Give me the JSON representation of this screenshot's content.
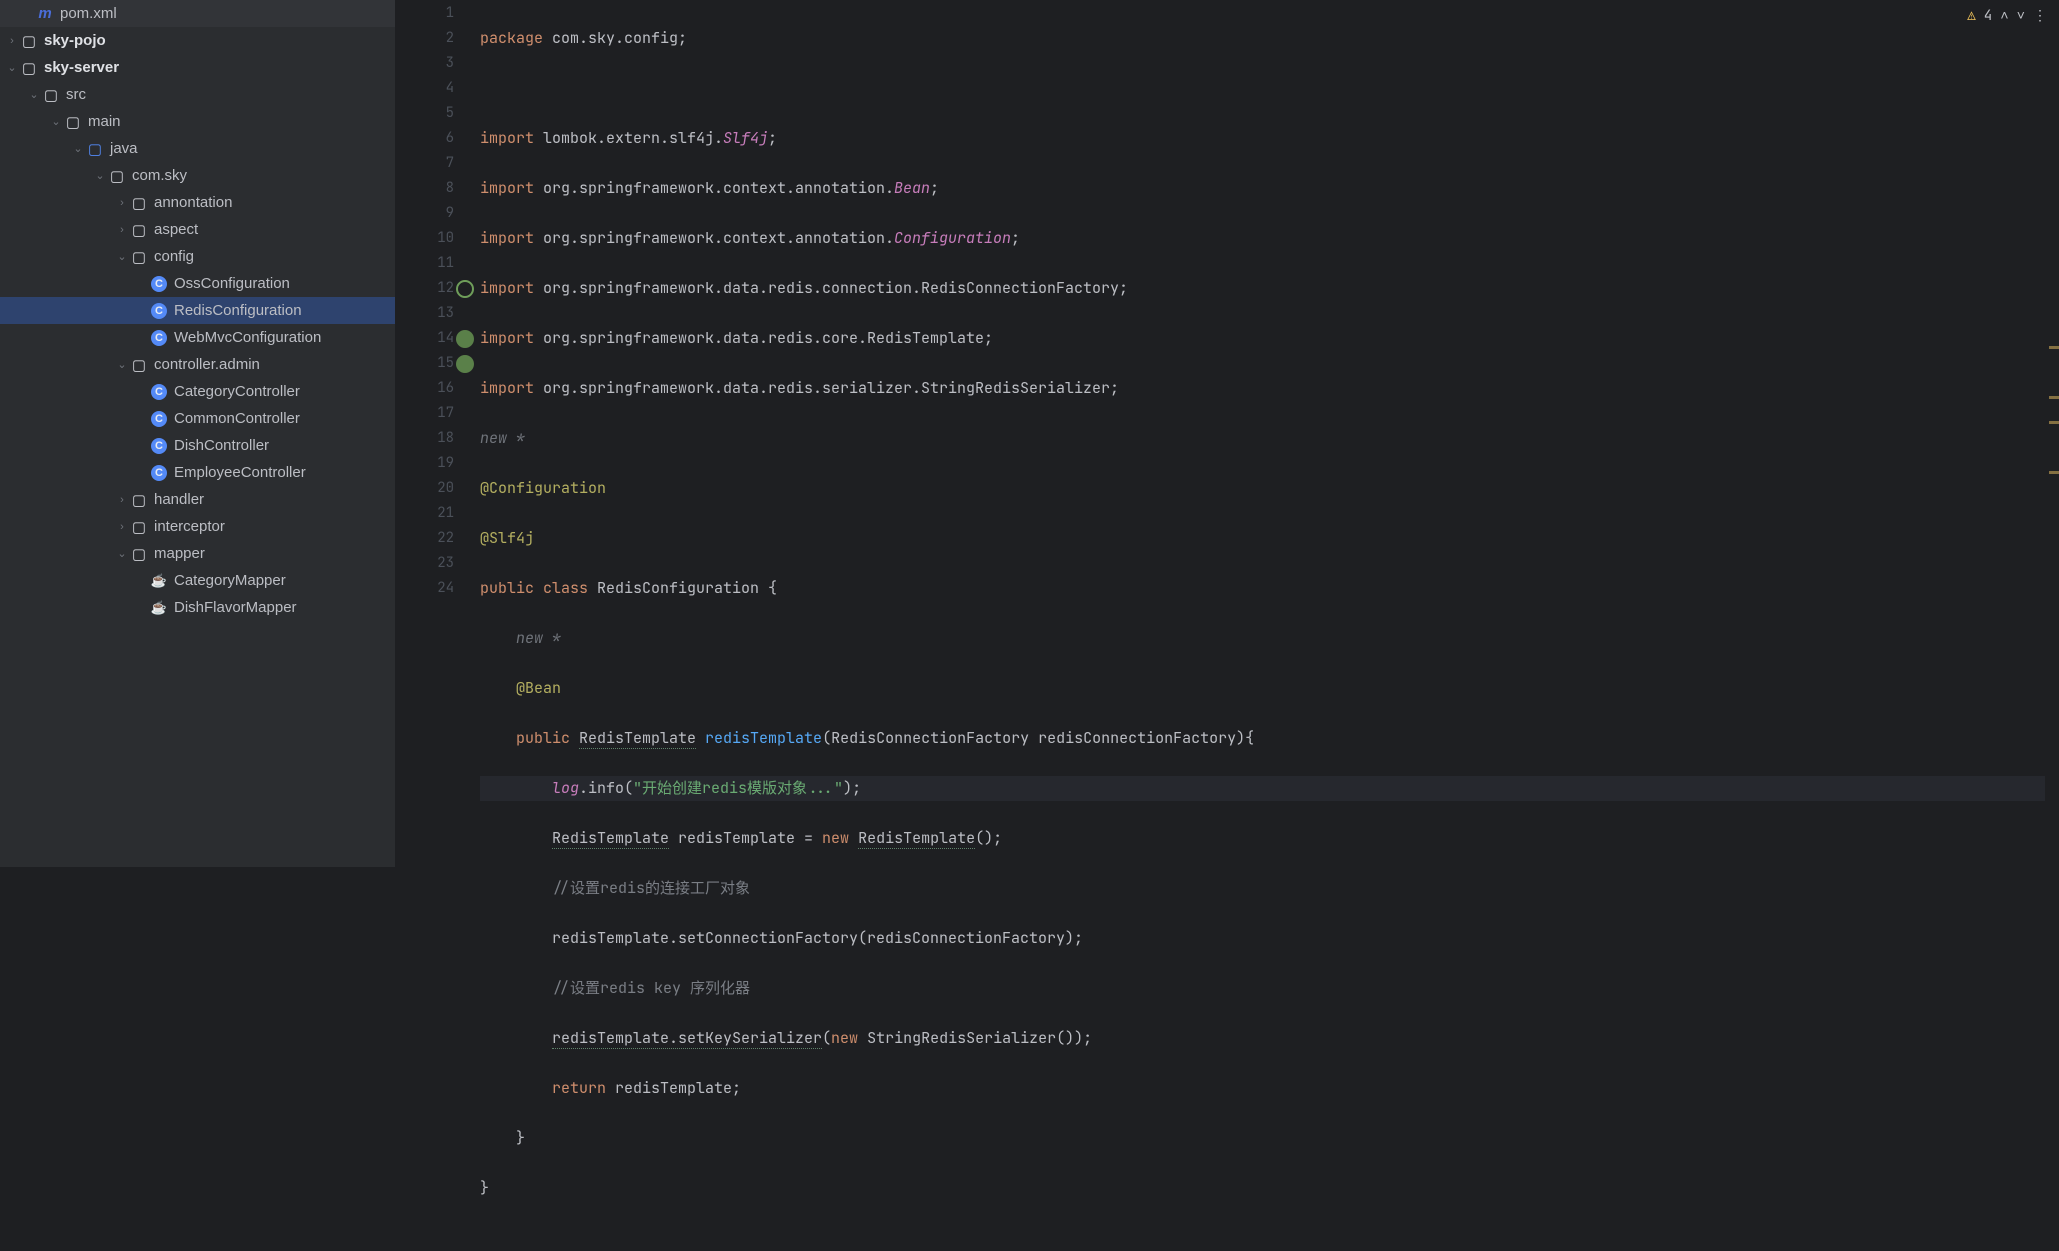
{
  "tree": {
    "pom": "pom.xml",
    "pojo": "sky-pojo",
    "server": "sky-server",
    "src": "src",
    "main": "main",
    "java": "java",
    "comsky": "com.sky",
    "annontation": "annontation",
    "aspect": "aspect",
    "config": "config",
    "oss": "OssConfiguration",
    "redis": "RedisConfiguration",
    "webmvc": "WebMvcConfiguration",
    "controllerAdmin": "controller.admin",
    "cat": "CategoryController",
    "common": "CommonController",
    "dish": "DishController",
    "emp": "EmployeeController",
    "handler": "handler",
    "interceptor": "interceptor",
    "mapper": "mapper",
    "catMapper": "CategoryMapper",
    "dishFlavorMapper": "DishFlavorMapper"
  },
  "gutter": {
    "lines": [
      "1",
      "2",
      "3",
      "4",
      "5",
      "6",
      "7",
      "8",
      "9",
      "10",
      "11",
      "12",
      "13",
      "14",
      "15",
      "16",
      "17",
      "18",
      "19",
      "20",
      "21",
      "22",
      "23",
      "24"
    ]
  },
  "code": {
    "l1_pkg": "package ",
    "l1_path": "com.sky.config;",
    "l3a": "import ",
    "l3b": "lombok.extern.slf4j.",
    "l3c": "Slf4j",
    "l3d": ";",
    "l4a": "import ",
    "l4b": "org.springframework.context.annotation.",
    "l4c": "Bean",
    "l4d": ";",
    "l5a": "import ",
    "l5b": "org.springframework.context.annotation.",
    "l5c": "Configuration",
    "l5d": ";",
    "l6a": "import ",
    "l6b": "org.springframework.data.redis.connection.RedisConnectionFactory;",
    "l7a": "import ",
    "l7b": "org.springframework.data.redis.core.RedisTemplate;",
    "l8a": "import ",
    "l8b": "org.springframework.data.redis.serializer.StringRedisSerializer;",
    "l9_hint": "new *",
    "l10": "@Configuration",
    "l11": "@Slf4j",
    "l12a": "public ",
    "l12b": "class ",
    "l12c": "RedisConfiguration {",
    "l13_hint": "    new *",
    "l14": "    @Bean",
    "l15a": "    public ",
    "l15b": "RedisTemplate",
    "l15c": " ",
    "l15d": "redisTemplate",
    "l15e": "(RedisConnectionFactory redisConnectionFactory){",
    "l16a": "        ",
    "l16b": "log",
    "l16c": ".info(",
    "l16d": "\"开始创建redis模版对象...\"",
    "l16e": ");",
    "l17a": "        ",
    "l17b": "RedisTemplate",
    "l17c": " redisTemplate = ",
    "l17d": "new ",
    "l17e": "RedisTemplate",
    "l17f": "();",
    "l18": "        //设置redis的连接工厂对象",
    "l19": "        redisTemplate.setConnectionFactory(redisConnectionFactory);",
    "l20": "        //设置redis key 序列化器",
    "l21a": "        ",
    "l21b": "redisTemplate.setKeySerializer",
    "l21c": "(",
    "l21d": "new ",
    "l21e": "StringRedisSerializer());",
    "l22a": "        return ",
    "l22b": "redisTemplate;",
    "l23": "    }",
    "l24": "}"
  },
  "warn": {
    "count": "4"
  }
}
